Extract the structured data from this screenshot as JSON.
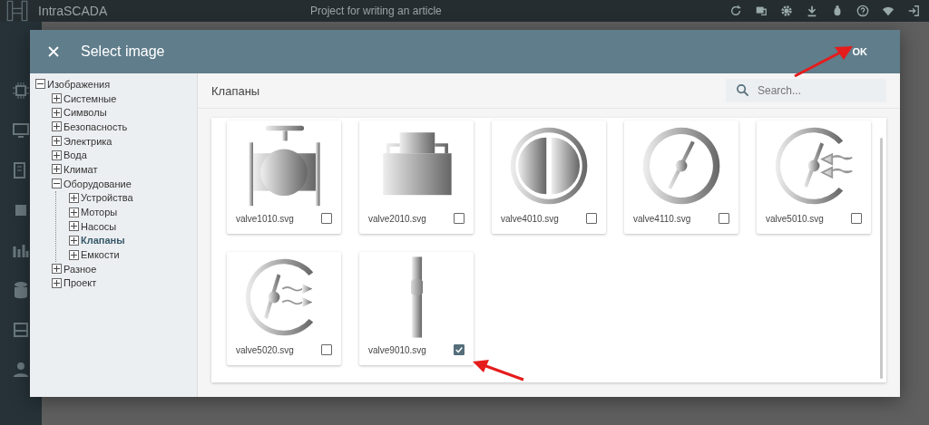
{
  "app": {
    "title": "IntraSCADA",
    "project": "Project for writing an article"
  },
  "dialog": {
    "title": "Select image",
    "ok": "OK"
  },
  "tree": [
    {
      "label": "Изображения",
      "expanded": true,
      "selected": false,
      "children": [
        {
          "label": "Системные",
          "expanded": false,
          "selected": false
        },
        {
          "label": "Символы",
          "expanded": false,
          "selected": false
        },
        {
          "label": "Безопасность",
          "expanded": false,
          "selected": false
        },
        {
          "label": "Электрика",
          "expanded": false,
          "selected": false
        },
        {
          "label": "Вода",
          "expanded": false,
          "selected": false
        },
        {
          "label": "Климат",
          "expanded": false,
          "selected": false
        },
        {
          "label": "Оборудование",
          "expanded": true,
          "selected": false,
          "children": [
            {
              "label": "Устройства",
              "expanded": false,
              "selected": false
            },
            {
              "label": "Моторы",
              "expanded": false,
              "selected": false
            },
            {
              "label": "Насосы",
              "expanded": false,
              "selected": false
            },
            {
              "label": "Клапаны",
              "expanded": false,
              "selected": true
            },
            {
              "label": "Емкости",
              "expanded": false,
              "selected": false
            }
          ]
        },
        {
          "label": "Разное",
          "expanded": false,
          "selected": false
        },
        {
          "label": "Проект",
          "expanded": false,
          "selected": false
        }
      ]
    }
  ],
  "folder": {
    "title": "Клапаны",
    "search": {
      "placeholder": "Search..."
    }
  },
  "images": [
    {
      "name": "valve1010.svg",
      "kind": "globe",
      "checked": false
    },
    {
      "name": "valve2010.svg",
      "kind": "box",
      "checked": false
    },
    {
      "name": "valve4010.svg",
      "kind": "halves",
      "checked": false
    },
    {
      "name": "valve4110.svg",
      "kind": "butterfly",
      "checked": false
    },
    {
      "name": "valve5010.svg",
      "kind": "flowin",
      "checked": false
    },
    {
      "name": "valve5020.svg",
      "kind": "flowout",
      "checked": false
    },
    {
      "name": "valve9010.svg",
      "kind": "slider",
      "checked": true
    }
  ]
}
